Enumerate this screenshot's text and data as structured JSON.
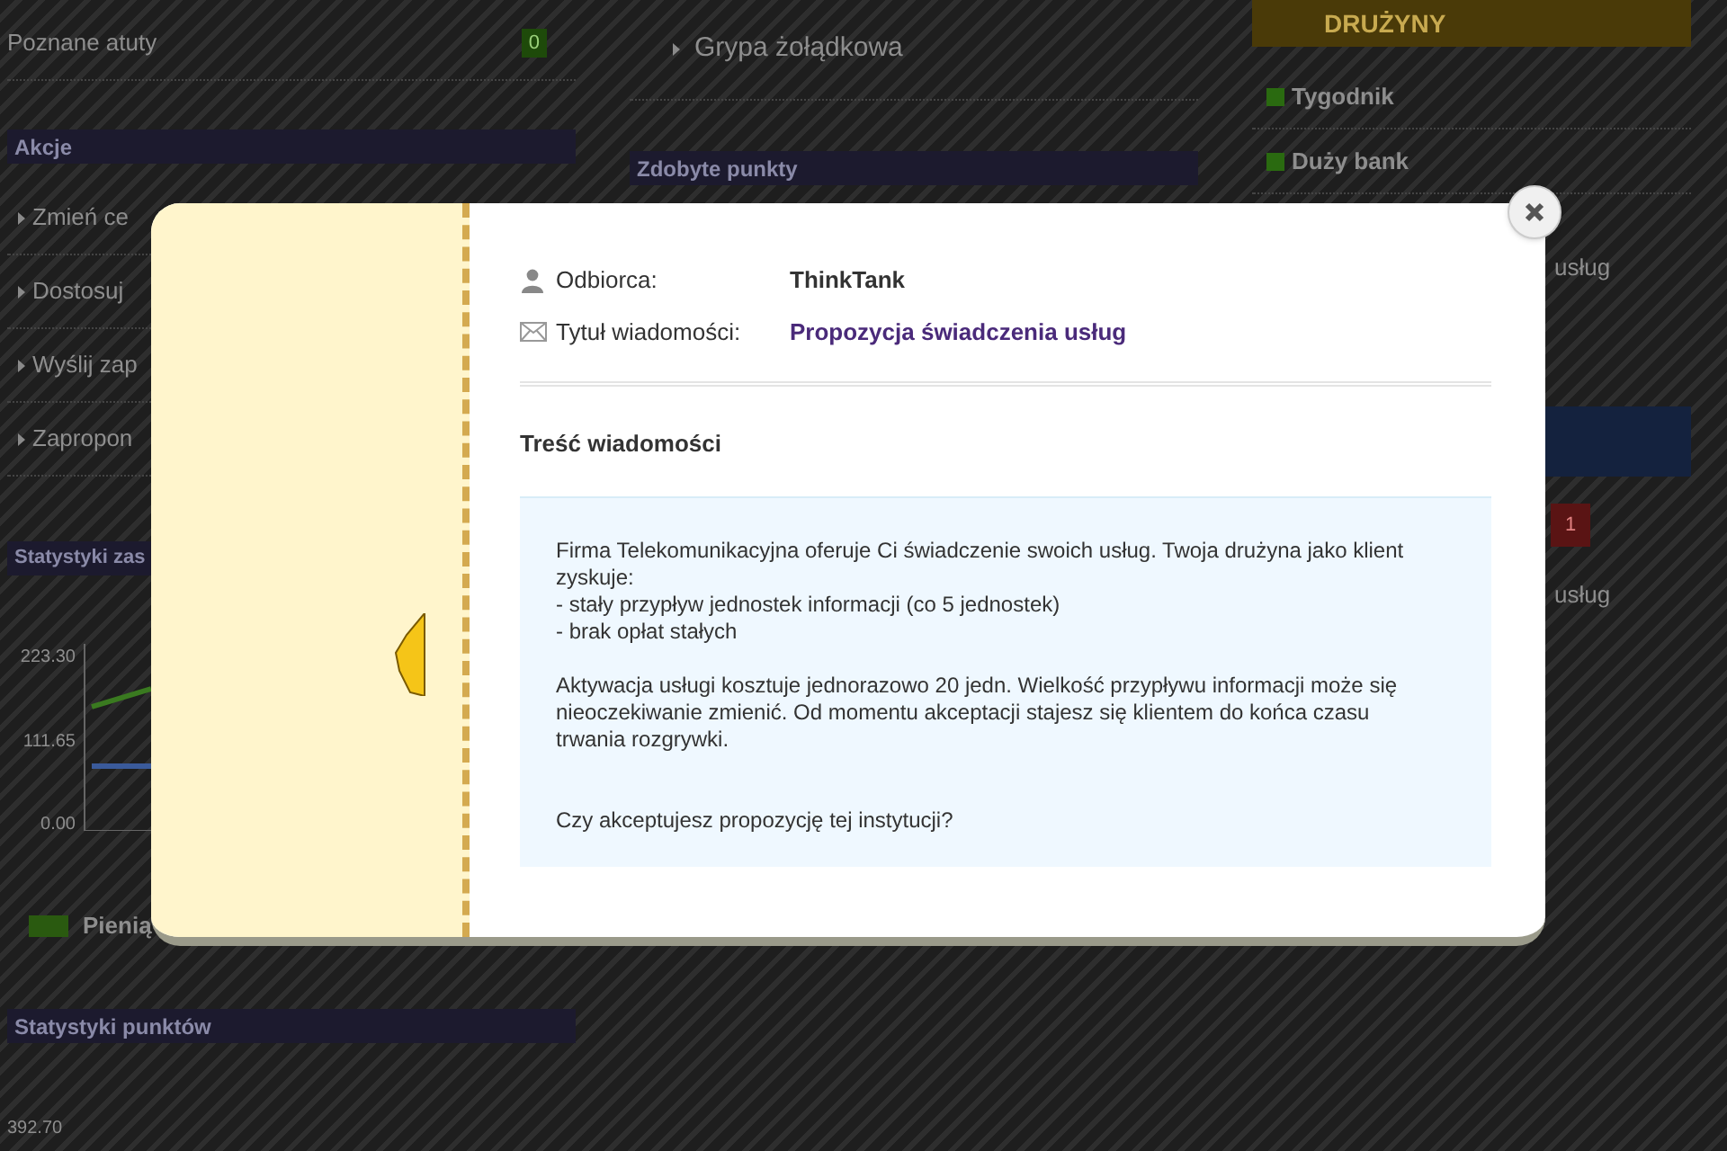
{
  "left_column": {
    "stats_rows": [
      {
        "label": "Poznane atuty",
        "count": "0"
      }
    ],
    "actions_panel": {
      "title": "Akcje",
      "items": [
        "Zmień ce",
        "Dostosuj",
        "Wyślij zap",
        "Zapropon"
      ]
    },
    "chart_panel": {
      "title": "Statystyki zas",
      "y_ticks": [
        "223.30",
        "111.65",
        "0.00"
      ],
      "legend": "Pienią"
    },
    "points_panel": {
      "title": "Statystyki punktów",
      "y_ticks": [
        "392.70"
      ]
    }
  },
  "middle_column": {
    "list_items": [
      "Grypa żołądkowa"
    ],
    "points_panel": {
      "title": "Zdobyte punkty"
    }
  },
  "right_column": {
    "teams_panel": {
      "title": "DRUŻYNY",
      "items": [
        "Tygodnik",
        "Duży bank"
      ]
    },
    "service_rows": [
      "usług"
    ],
    "badge": "1",
    "service_rows_2": [
      "usług"
    ]
  },
  "modal": {
    "fields": [
      {
        "kind": "person",
        "label": "Odbiorca:",
        "value": "ThinkTank"
      },
      {
        "kind": "mail",
        "label": "Tytuł wiadomości:",
        "value": "Propozycja świadczenia usług"
      }
    ],
    "body_title": "Treść wiadomości",
    "paragraphs": [
      "Firma Telekomunikacyjna oferuje Ci świadczenie swoich usług. Twoja drużyna jako klient zyskuje:\n- stały przypływ jednostek informacji (co 5 jednostek)\n- brak opłat stałych",
      "Aktywacja usługi kosztuje jednorazowo 20 jedn. Wielkość przypływu informacji może się nieoczekiwanie zmienić. Od momentu akceptacji stajesz się klientem do końca czasu trwania rozgrywki.",
      "Czy akceptujesz propozycję tej instytucji?"
    ]
  }
}
